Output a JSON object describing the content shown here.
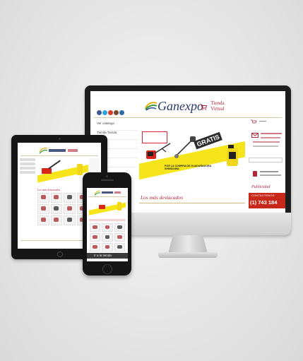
{
  "brand": {
    "logo_text": "Ganexpo",
    "logo_sub": "Tienda Virtual"
  },
  "monitor": {
    "menu_items": [
      "Ver catalogo",
      "Tienda Tienda",
      "",
      "",
      ""
    ],
    "banner": {
      "gratis": "GRATIS",
      "caption": "POR LA COMPRA DE GUADAÑADORA SHINDAIWA"
    },
    "section_title": "Los más destacados",
    "right": {
      "publicidad": "Publicidad",
      "contact_label": "CONTACTENOS",
      "contact_phone": "(1) 743 184"
    }
  },
  "tablet": {
    "section_title": "Los más destacados"
  },
  "phone": {
    "footer_label": "Ir a la tienda"
  },
  "colors": {
    "brand_red": "#b0263a",
    "brand_blue": "#2a3a6a",
    "banner_yellow": "#f7e51c",
    "contact_red": "#c8281a"
  },
  "icons": [
    "facebook-icon",
    "twitter-icon",
    "google-plus-icon",
    "instagram-icon",
    "youtube-icon",
    "cart-icon",
    "mail-icon",
    "phone-icon"
  ]
}
